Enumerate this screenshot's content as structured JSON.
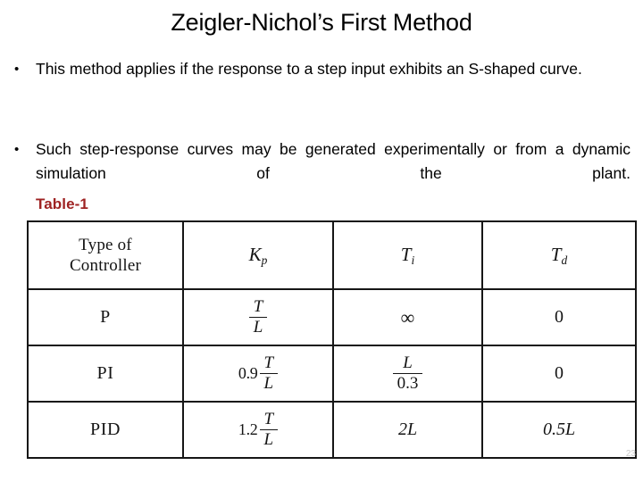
{
  "slide": {
    "title": "Zeigler-Nichol’s First Method",
    "page_number": "23",
    "background_color": "#ffffff"
  },
  "bullets": [
    {
      "marker": "•",
      "text": "This method applies if the response to a step input exhibits an S-shaped curve."
    },
    {
      "marker": "•",
      "text": "Such step-response curves may be generated experimentally or from a dynamic simulation of the plant."
    }
  ],
  "table": {
    "caption": "Table-1",
    "caption_color": "#9E2222",
    "headers": {
      "col1_line1": "Type of",
      "col1_line2": "Controller",
      "col2_symbol": "K",
      "col2_subscript": "p",
      "col3_symbol": "T",
      "col3_subscript": "i",
      "col4_symbol": "T",
      "col4_subscript": "d"
    },
    "rows": [
      {
        "controller": "P",
        "kp": {
          "coefficient": "",
          "numerator": "T",
          "denominator": "L"
        },
        "ti": "∞",
        "td": "0"
      },
      {
        "controller": "PI",
        "kp": {
          "coefficient": "0.9",
          "numerator": "T",
          "denominator": "L"
        },
        "ti_fraction": {
          "numerator": "L",
          "denominator": "0.3"
        },
        "td": "0"
      },
      {
        "controller": "PID",
        "kp": {
          "coefficient": "1.2",
          "numerator": "T",
          "denominator": "L"
        },
        "ti": "2L",
        "td": "0.5L"
      }
    ]
  }
}
